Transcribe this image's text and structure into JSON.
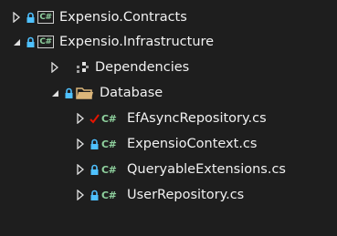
{
  "colors": {
    "background": "#1e1e1e",
    "text": "#f1f1f1",
    "csharp_green": "#8fd19e",
    "lock_blue": "#4fc1ff",
    "check_red": "#e51400",
    "folder_yellow": "#dcb67a"
  },
  "tree": {
    "contracts": {
      "label": "Expensio.Contracts",
      "icon": "csharp-project-icon",
      "state": "collapsed"
    },
    "infrastructure": {
      "label": "Expensio.Infrastructure",
      "icon": "csharp-project-icon",
      "state": "expanded"
    },
    "dependencies": {
      "label": "Dependencies",
      "icon": "dependencies-icon",
      "state": "collapsed"
    },
    "database": {
      "label": "Database",
      "icon": "folder-icon",
      "state": "expanded"
    },
    "files": [
      {
        "label": "EfAsyncRepository.cs",
        "status": "checked-out",
        "icon_text": "C#"
      },
      {
        "label": "ExpensioContext.cs",
        "status": "locked",
        "icon_text": "C#"
      },
      {
        "label": "QueryableExtensions.cs",
        "status": "locked",
        "icon_text": "C#"
      },
      {
        "label": "UserRepository.cs",
        "status": "locked",
        "icon_text": "C#"
      }
    ],
    "project_icon_text": "C#"
  }
}
